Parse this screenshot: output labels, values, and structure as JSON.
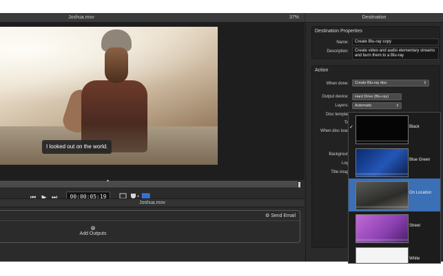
{
  "viewer": {
    "filename": "Joshua.mov",
    "zoom": "37%",
    "subtitle": "I looked out on the world.",
    "timecode": "00:00:05;19"
  },
  "batch": {
    "filename": "Joshua.mov",
    "send_email_label": "Send Email",
    "add_outputs_label": "Add Outputs"
  },
  "inspector": {
    "title": "Destination",
    "properties": {
      "section_title": "Destination Properties",
      "name_label": "Name:",
      "name_value": "Create Blu-ray copy",
      "description_label": "Description:",
      "description_value": "Create video and audio elementary streams and burn them to a Blu-ray"
    },
    "action": {
      "section_title": "Action",
      "when_done_label": "When done:",
      "when_done_value": "Create Blu-ray disc",
      "output_device_label": "Output device:",
      "output_device_value": "Hard Drive (Blu-ray)",
      "layers_label": "Layers:",
      "layers_value": "Automatic",
      "disc_template_label": "Disc templat",
      "title_label": "Tit",
      "when_disc_loads_label": "When disc load",
      "background_label": "Backgroun",
      "logo_label": "Log",
      "title_image_label": "Title imag"
    }
  },
  "themes": [
    {
      "name": "Black",
      "selected": false,
      "checked": true
    },
    {
      "name": "Blue Green",
      "selected": false,
      "checked": false
    },
    {
      "name": "On Location",
      "selected": true,
      "checked": false
    },
    {
      "name": "Street",
      "selected": false,
      "checked": false
    },
    {
      "name": "White",
      "selected": false,
      "checked": false
    }
  ],
  "colors": {
    "selection": "#3b6fb6",
    "panel": "#2b2b2b",
    "accent_button": "#2f6fd6"
  }
}
